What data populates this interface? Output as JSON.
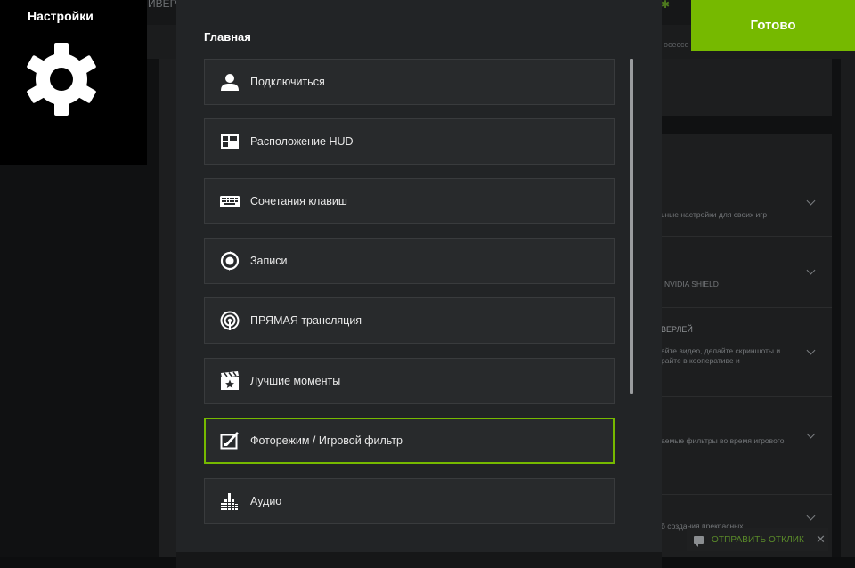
{
  "settings_tile": {
    "title": "Настройки",
    "icon": "gear-icon"
  },
  "done_button": {
    "label": "Готово"
  },
  "panel": {
    "heading": "Главная",
    "items": [
      {
        "label": "Подключиться",
        "icon": "user-icon",
        "selected": false
      },
      {
        "label": "Расположение HUD",
        "icon": "hud-layout-icon",
        "selected": false
      },
      {
        "label": "Сочетания клавиш",
        "icon": "keyboard-icon",
        "selected": false
      },
      {
        "label": "Записи",
        "icon": "recordings-icon",
        "selected": false
      },
      {
        "label": "ПРЯМАЯ трансляция",
        "icon": "broadcast-icon",
        "selected": false
      },
      {
        "label": "Лучшие моменты",
        "icon": "highlights-icon",
        "selected": false
      },
      {
        "label": "Фоторежим / Игровой фильтр",
        "icon": "photo-mode-icon",
        "selected": true
      },
      {
        "label": "Аудио",
        "icon": "audio-equalizer-icon",
        "selected": false
      }
    ]
  },
  "background": {
    "top_tab": "ИВЕРЬ",
    "sub_tab": "ocecco",
    "rows": [
      {
        "title": "",
        "desc": "ьные настройки для своих игр"
      },
      {
        "title": "",
        "desc": "NVIDIA SHIELD"
      },
      {
        "title": "ВЕРЛЕЙ",
        "desc": "айте видео, делайте скриншоты и\nрайте в кооперативе и"
      },
      {
        "title": "",
        "desc": "аемые фильтры во время игрового"
      },
      {
        "title": "",
        "desc": "б создания прекрасных"
      }
    ],
    "feedback": {
      "label": "ОТПРАВИТЬ ОТКЛИК",
      "icon": "feedback-icon",
      "close_icon": "close-icon"
    }
  },
  "colors": {
    "accent": "#76b900",
    "panel": "#222426",
    "item": "#282a2c"
  }
}
